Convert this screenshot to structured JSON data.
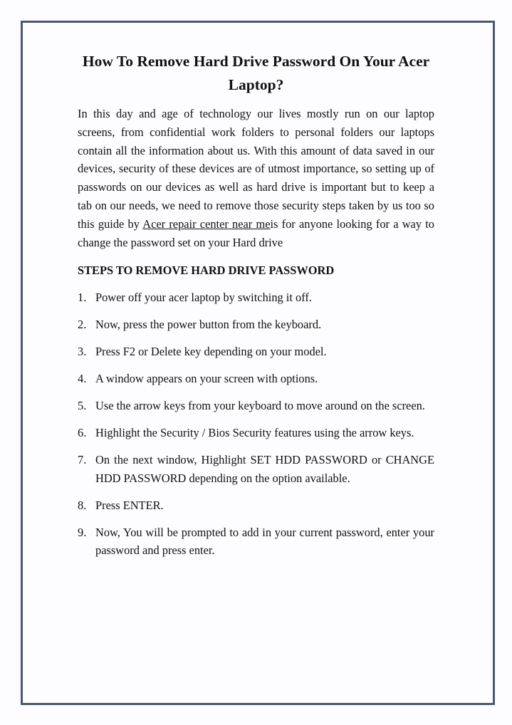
{
  "document": {
    "title": "How To Remove Hard Drive Password On Your Acer Laptop?",
    "intro": {
      "before_link": "In this day and age of technology our lives mostly run on our laptop screens, from confidential work folders to personal folders our laptops contain all the information about us. With this amount of data saved in our devices, security of these devices are of utmost importance, so setting up of passwords on our devices as well as hard drive is important but to keep a tab on our needs, we need to remove those security steps taken by us too so this guide by ",
      "link_text": "Acer repair center near me",
      "after_link": "is for anyone looking for a way to change the password set on your Hard drive"
    },
    "steps_heading": "STEPS TO REMOVE HARD DRIVE PASSWORD",
    "steps": [
      {
        "num": "1.",
        "text": "Power off your acer laptop by switching it off."
      },
      {
        "num": "2.",
        "text": "Now, press the power button from the keyboard."
      },
      {
        "num": "3.",
        "text": "Press F2 or Delete key depending on your model."
      },
      {
        "num": "4.",
        "text": "A window appears on your screen with options."
      },
      {
        "num": "5.",
        "text": "Use the arrow keys from your keyboard to move around on the screen."
      },
      {
        "num": "6.",
        "text": "Highlight the Security / Bios Security features using the arrow keys."
      },
      {
        "num": "7.",
        "text": "On the next window, Highlight SET HDD PASSWORD or CHANGE HDD PASSWORD depending on the option available."
      },
      {
        "num": "8.",
        "text": "Press ENTER."
      },
      {
        "num": "9.",
        "text": "Now, You will be prompted to add in your current password, enter your password and press enter."
      }
    ]
  },
  "colors": {
    "border": "#4e586b",
    "text": "#111111",
    "background": "#fdfcfe"
  }
}
